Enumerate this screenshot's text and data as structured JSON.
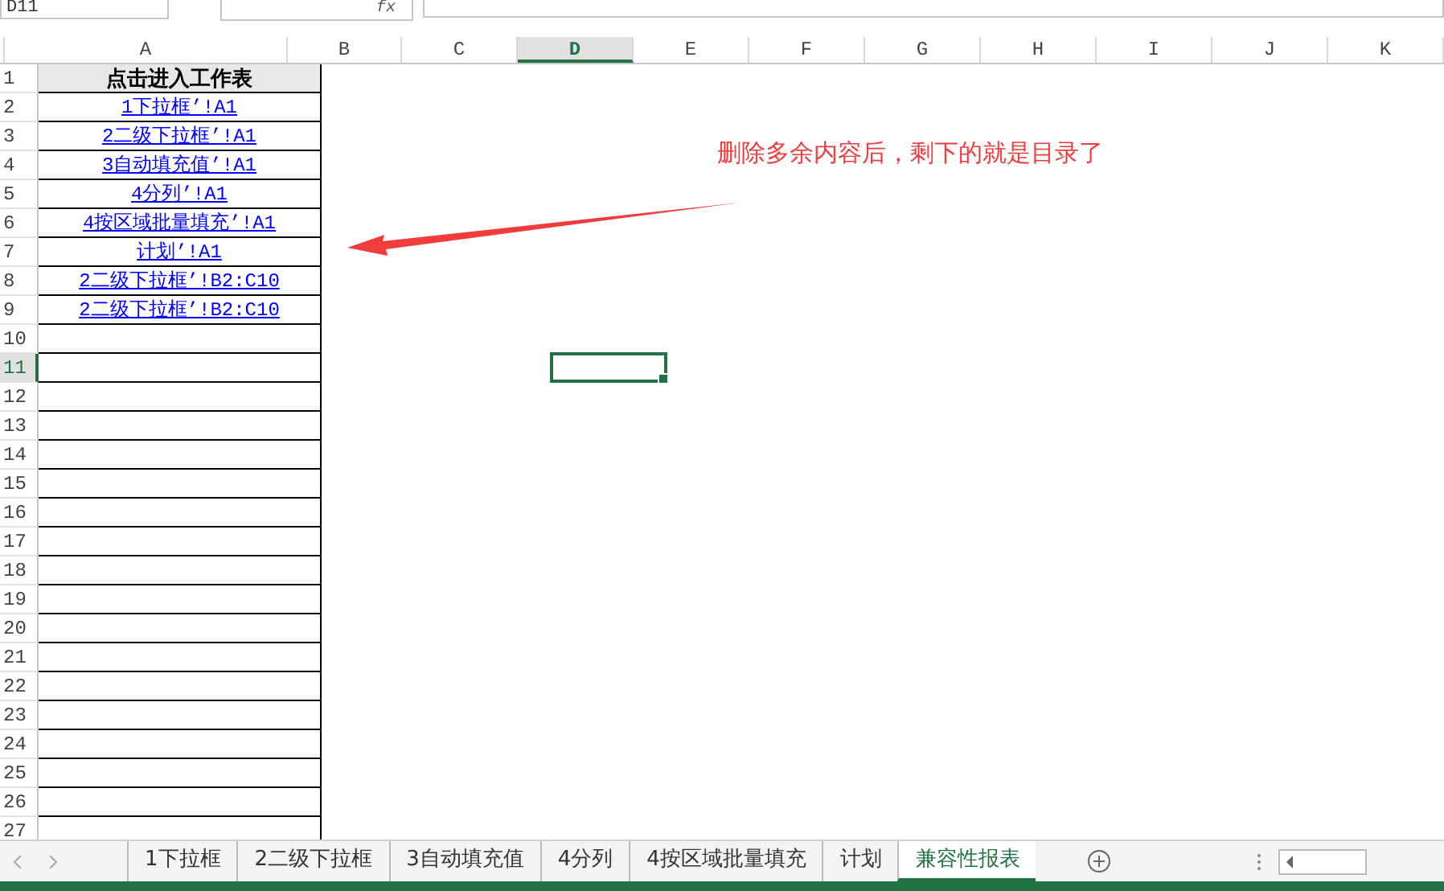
{
  "name_box": {
    "value": "D11"
  },
  "formula_bar": {
    "fx": "fx"
  },
  "columns": [
    {
      "label": "A",
      "selected": false
    },
    {
      "label": "B",
      "selected": false
    },
    {
      "label": "C",
      "selected": false
    },
    {
      "label": "D",
      "selected": true
    },
    {
      "label": "E",
      "selected": false
    },
    {
      "label": "F",
      "selected": false
    },
    {
      "label": "G",
      "selected": false
    },
    {
      "label": "H",
      "selected": false
    },
    {
      "label": "I",
      "selected": false
    },
    {
      "label": "J",
      "selected": false
    },
    {
      "label": "K",
      "selected": false
    }
  ],
  "rows": [
    {
      "number": "1",
      "selected": false,
      "cell_a": {
        "kind": "header",
        "text": "点击进入工作表"
      }
    },
    {
      "number": "2",
      "selected": false,
      "cell_a": {
        "kind": "link",
        "text": "1下拉框’!A1"
      }
    },
    {
      "number": "3",
      "selected": false,
      "cell_a": {
        "kind": "link",
        "text": "2二级下拉框’!A1"
      }
    },
    {
      "number": "4",
      "selected": false,
      "cell_a": {
        "kind": "link",
        "text": "3自动填充值’!A1"
      }
    },
    {
      "number": "5",
      "selected": false,
      "cell_a": {
        "kind": "link",
        "text": "4分列’!A1"
      }
    },
    {
      "number": "6",
      "selected": false,
      "cell_a": {
        "kind": "link",
        "text": "4按区域批量填充’!A1"
      }
    },
    {
      "number": "7",
      "selected": false,
      "cell_a": {
        "kind": "link",
        "text": "计划’!A1"
      }
    },
    {
      "number": "8",
      "selected": false,
      "cell_a": {
        "kind": "link",
        "text": "2二级下拉框’!B2:C10"
      }
    },
    {
      "number": "9",
      "selected": false,
      "cell_a": {
        "kind": "link",
        "text": "2二级下拉框’!B2:C10"
      }
    },
    {
      "number": "10",
      "selected": false
    },
    {
      "number": "11",
      "selected": true
    },
    {
      "number": "12",
      "selected": false
    },
    {
      "number": "13",
      "selected": false
    },
    {
      "number": "14",
      "selected": false
    },
    {
      "number": "15",
      "selected": false
    },
    {
      "number": "16",
      "selected": false
    },
    {
      "number": "17",
      "selected": false
    },
    {
      "number": "18",
      "selected": false
    },
    {
      "number": "19",
      "selected": false
    },
    {
      "number": "20",
      "selected": false
    },
    {
      "number": "21",
      "selected": false
    },
    {
      "number": "22",
      "selected": false
    },
    {
      "number": "23",
      "selected": false
    },
    {
      "number": "24",
      "selected": false
    },
    {
      "number": "25",
      "selected": false
    },
    {
      "number": "26",
      "selected": false
    },
    {
      "number": "27",
      "selected": false
    }
  ],
  "annotation": {
    "text": "删除多余内容后，剩下的就是目录了"
  },
  "tabs": [
    {
      "label": "1下拉框",
      "selected": false
    },
    {
      "label": "2二级下拉框",
      "selected": false
    },
    {
      "label": "3自动填充值",
      "selected": false
    },
    {
      "label": "4分列",
      "selected": false
    },
    {
      "label": "4按区域批量填充",
      "selected": false
    },
    {
      "label": "计划",
      "selected": false
    },
    {
      "label": "兼容性报表",
      "selected": true
    }
  ]
}
